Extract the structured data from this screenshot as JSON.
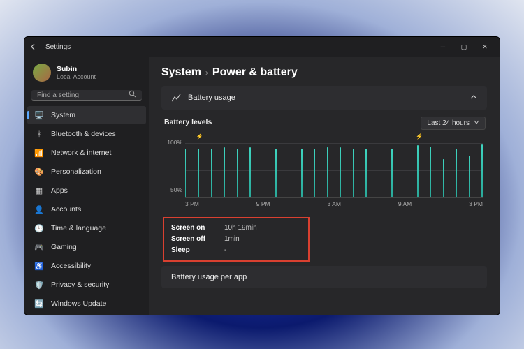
{
  "app": {
    "title": "Settings"
  },
  "user": {
    "name": "Subin",
    "account_type": "Local Account"
  },
  "search": {
    "placeholder": "Find a setting"
  },
  "sidebar": {
    "items": [
      {
        "label": "System",
        "icon": "monitor-icon",
        "selected": true
      },
      {
        "label": "Bluetooth & devices",
        "icon": "bluetooth-icon"
      },
      {
        "label": "Network & internet",
        "icon": "wifi-icon"
      },
      {
        "label": "Personalization",
        "icon": "paint-icon"
      },
      {
        "label": "Apps",
        "icon": "apps-icon"
      },
      {
        "label": "Accounts",
        "icon": "person-icon"
      },
      {
        "label": "Time & language",
        "icon": "clock-icon"
      },
      {
        "label": "Gaming",
        "icon": "gamepad-icon"
      },
      {
        "label": "Accessibility",
        "icon": "accessibility-icon"
      },
      {
        "label": "Privacy & security",
        "icon": "shield-icon"
      },
      {
        "label": "Windows Update",
        "icon": "update-icon"
      }
    ]
  },
  "breadcrumb": {
    "root": "System",
    "page": "Power & battery"
  },
  "battery_usage_panel": {
    "title": "Battery usage"
  },
  "battery_levels": {
    "title": "Battery levels",
    "range_label": "Last 24 hours"
  },
  "chart_data": {
    "type": "bar",
    "ylabel": "",
    "ylim": [
      0,
      100
    ],
    "ytick_labels": [
      "100%",
      "50%"
    ],
    "xtick_labels": [
      "3 PM",
      "9 PM",
      "3 AM",
      "9 AM",
      "3 PM"
    ],
    "charging_markers_at_index": [
      1,
      18
    ],
    "values": [
      90,
      90,
      90,
      92,
      90,
      92,
      90,
      90,
      90,
      90,
      90,
      92,
      92,
      90,
      90,
      90,
      90,
      90,
      96,
      94,
      70,
      90,
      76,
      98
    ]
  },
  "screen_stats": {
    "rows": [
      {
        "k": "Screen on",
        "v": "10h 19min"
      },
      {
        "k": "Screen off",
        "v": "1min"
      },
      {
        "k": "Sleep",
        "v": "-"
      }
    ]
  },
  "per_app": {
    "title": "Battery usage per app"
  },
  "icon_glyphs": {
    "monitor-icon": "🖥️",
    "bluetooth-icon": "ᚼ",
    "wifi-icon": "📶",
    "paint-icon": "🎨",
    "apps-icon": "▦",
    "person-icon": "👤",
    "clock-icon": "🕑",
    "gamepad-icon": "🎮",
    "accessibility-icon": "♿",
    "shield-icon": "🛡️",
    "update-icon": "🔄",
    "chart-icon": "📈"
  }
}
